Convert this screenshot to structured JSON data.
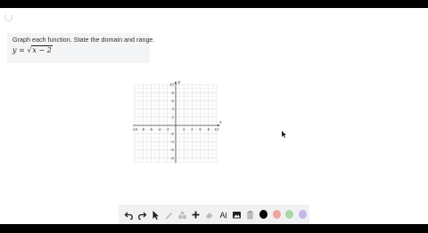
{
  "problem": {
    "instruction": "Graph each function. State the domain and range.",
    "equation_lhs": "y =",
    "equation_radical": "√",
    "equation_radicand": "x − 2"
  },
  "graph": {
    "x_axis_label": "x",
    "y_axis_label": "y",
    "x_ticks": [
      "-10",
      "-8",
      "-6",
      "-4",
      "-2",
      "2",
      "4",
      "6",
      "8",
      "10"
    ],
    "y_ticks": [
      "10",
      "8",
      "6",
      "4",
      "2",
      "-2",
      "-4",
      "-6",
      "-8"
    ],
    "x_range": [
      -10,
      10
    ],
    "y_range": [
      -9,
      10
    ],
    "grid": true
  },
  "toolbar": {
    "tools": [
      {
        "name": "undo-icon",
        "glyph": "undo"
      },
      {
        "name": "redo-icon",
        "glyph": "redo"
      },
      {
        "name": "pointer-icon",
        "glyph": "pointer"
      },
      {
        "name": "pen-icon",
        "glyph": "pen"
      },
      {
        "name": "shapes-icon",
        "glyph": "shapes"
      },
      {
        "name": "add-icon",
        "glyph": "plus"
      },
      {
        "name": "eraser-icon",
        "glyph": "eraser"
      },
      {
        "name": "text-icon",
        "glyph": "text"
      },
      {
        "name": "image-icon",
        "glyph": "image"
      },
      {
        "name": "clipboard-icon",
        "glyph": "clipboard"
      }
    ],
    "colors": [
      "#000000",
      "#f0a3a3",
      "#a8d8a8",
      "#c3b6ec"
    ]
  }
}
